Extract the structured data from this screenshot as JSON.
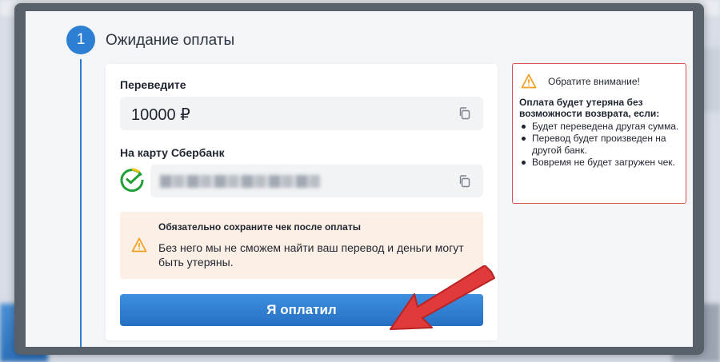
{
  "step": {
    "number": "1",
    "title": "Ожидание оплаты"
  },
  "payment": {
    "transfer_label": "Переведите",
    "amount": "10000 ₽",
    "card_label": "На карту Сбербанк",
    "card_number_blurred": true
  },
  "notice": {
    "title": "Обязательно сохраните чек после оплаты",
    "text": "Без него мы не сможем найти ваш перевод и деньги могут быть утеряны."
  },
  "pay_button_label": "Я оплатил",
  "warning": {
    "title": "Обратите внимание!",
    "lead": "Оплата будет утеряна без возможности возврата, если:",
    "items": [
      "Будет переведена другая сумма.",
      "Перевод будет произведен на другой банк.",
      "Вовремя не будет загружен чек."
    ]
  },
  "colors": {
    "accent": "#2d7fd3",
    "warning_border": "#d9534f",
    "notice_bg": "#fcefe5",
    "arrow": "#e03a3a",
    "sber_green": "#21a038"
  },
  "icons": {
    "copy": "copy-icon",
    "warning": "warning-triangle-icon",
    "bank": "sberbank-logo-icon"
  }
}
